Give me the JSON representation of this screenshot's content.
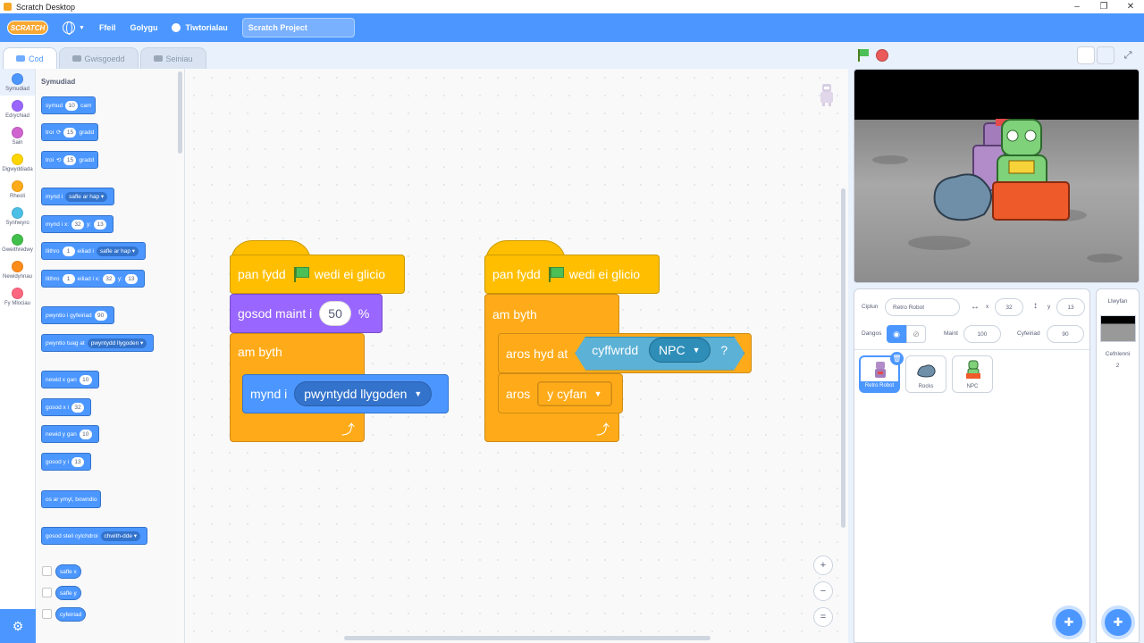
{
  "window": {
    "title": "Scratch Desktop",
    "controls": [
      "–",
      "❐",
      "✕"
    ]
  },
  "menubar": {
    "logo": "SCRATCH",
    "file": "Ffeil",
    "edit": "Golygu",
    "tutorials": "Tiwtorialau",
    "project_title": "Scratch Project"
  },
  "tabs": {
    "code": "Cod",
    "costumes": "Gwisgoedd",
    "sounds": "Seiniau"
  },
  "categories": [
    {
      "label": "Symudiad",
      "color": "#4c97ff"
    },
    {
      "label": "Edrychiad",
      "color": "#9966ff"
    },
    {
      "label": "Sain",
      "color": "#cf63cf"
    },
    {
      "label": "Digwyddiada",
      "color": "#ffd500"
    },
    {
      "label": "Rheoli",
      "color": "#ffab19"
    },
    {
      "label": "Synhwyro",
      "color": "#4cbfe6"
    },
    {
      "label": "Gweithredwy",
      "color": "#40bf4a"
    },
    {
      "label": "Newidynnau",
      "color": "#ff8c1a"
    },
    {
      "label": "Fy Mlociau",
      "color": "#ff6680"
    }
  ],
  "palette": {
    "heading": "Symudiad",
    "move": {
      "a": "symud",
      "v": "10",
      "b": "cam"
    },
    "turn_r": {
      "a": "troi",
      "icon": "⟳",
      "v": "15",
      "b": "gradd"
    },
    "turn_l": {
      "a": "troi",
      "icon": "⟲",
      "v": "15",
      "b": "gradd"
    },
    "goto": {
      "a": "mynd i",
      "d": "safle ar hap"
    },
    "gotoxy": {
      "a": "mynd i x:",
      "x": "32",
      "b": "y:",
      "y": "13"
    },
    "glide": {
      "a": "llithro",
      "v": "1",
      "b": "eiliad i",
      "d": "safle ar hap"
    },
    "glidexy": {
      "a": "llithro",
      "v": "1",
      "b": "eiliad i x:",
      "x": "32",
      "c": "y:",
      "y": "13"
    },
    "point": {
      "a": "pwyntio i gyfeiriad",
      "v": "90"
    },
    "pointto": {
      "a": "pwyntio tuag at",
      "d": "pwyntydd llygoden"
    },
    "changex": {
      "a": "newid x gan",
      "v": "10"
    },
    "setx": {
      "a": "gosod x i",
      "v": "32"
    },
    "changey": {
      "a": "newid y gan",
      "v": "10"
    },
    "sety": {
      "a": "gosod y i",
      "v": "13"
    },
    "bounce": "os ar ymyl, bowndio",
    "rotstyle": {
      "a": "gosod steil cylchdroi",
      "d": "chwith-dde"
    },
    "rep_x": "safle x",
    "rep_y": "safle y",
    "rep_dir": "cyfeiriad"
  },
  "script1": {
    "hat_a": "pan fydd",
    "hat_b": "wedi ei glicio",
    "size_a": "gosod maint i",
    "size_v": "50",
    "size_b": "%",
    "forever": "am byth",
    "goto_a": "mynd i",
    "goto_d": "pwyntydd llygoden"
  },
  "script2": {
    "hat_a": "pan fydd",
    "hat_b": "wedi ei glicio",
    "forever": "am byth",
    "wait_a": "aros hyd at",
    "touch_a": "cyffwrdd",
    "touch_d": "NPC",
    "touch_q": "?",
    "wait2_a": "aros",
    "wait2_d": "y cyfan"
  },
  "sprite_info": {
    "sprite_label": "Ciplun",
    "sprite_name": "Retro Robot",
    "x_label": "x",
    "x": "32",
    "y_label": "y",
    "y": "13",
    "show_label": "Dangos",
    "size_label": "Maint",
    "size": "100",
    "dir_label": "Cyfeiriad",
    "dir": "90"
  },
  "sprites": [
    {
      "name": "Retro Robot",
      "selected": true
    },
    {
      "name": "Rocks",
      "selected": false
    },
    {
      "name": "NPC",
      "selected": false
    }
  ],
  "stage_panel": {
    "title": "Llwyfan",
    "backdrops_label": "Cefnlenni",
    "backdrops_count": "2"
  }
}
